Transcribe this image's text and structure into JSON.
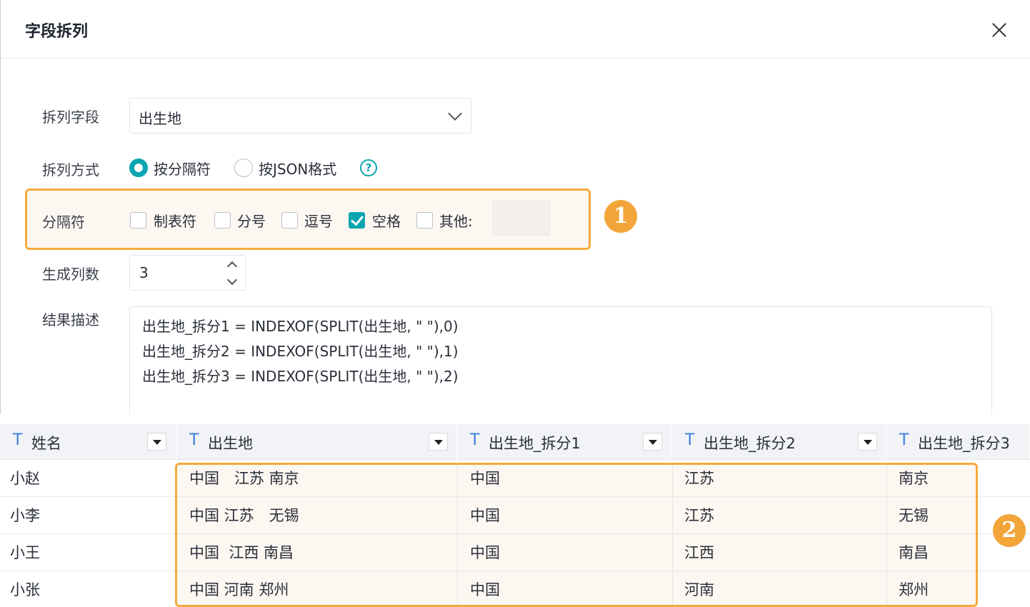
{
  "dialog": {
    "title": "字段拆列",
    "close_icon": "close-icon"
  },
  "form": {
    "split_field": {
      "label": "拆列字段",
      "value": "出生地"
    },
    "split_method": {
      "label": "拆列方式",
      "options": [
        {
          "label": "按分隔符",
          "selected": true
        },
        {
          "label": "按JSON格式",
          "selected": false
        }
      ],
      "help_icon": "?"
    },
    "separator": {
      "label": "分隔符",
      "options": [
        {
          "label": "制表符",
          "checked": false
        },
        {
          "label": "分号",
          "checked": false
        },
        {
          "label": "逗号",
          "checked": false
        },
        {
          "label": "空格",
          "checked": true
        },
        {
          "label": "其他:",
          "checked": false
        }
      ],
      "other_value": ""
    },
    "column_count": {
      "label": "生成列数",
      "value": "3"
    },
    "result": {
      "label": "结果描述",
      "lines": [
        "出生地_拆分1 = INDEXOF(SPLIT(出生地, \" \"),0)",
        "出生地_拆分2 = INDEXOF(SPLIT(出生地, \" \"),1)",
        "出生地_拆分3 = INDEXOF(SPLIT(出生地, \" \"),2)"
      ]
    }
  },
  "badges": {
    "one": "1",
    "two": "2"
  },
  "colors": {
    "accent": "#0aa5b0",
    "highlight": "#f3ab3c",
    "badge": "#f3a53a",
    "type_icon": "#3c7ee0"
  },
  "table": {
    "type_icon": "T",
    "columns": [
      "姓名",
      "出生地",
      "出生地_拆分1",
      "出生地_拆分2",
      "出生地_拆分3"
    ],
    "rows": [
      [
        "小赵",
        "中国　江苏 南京",
        "中国",
        "江苏",
        "南京"
      ],
      [
        "小李",
        "中国 江苏　无锡",
        "中国",
        "江苏",
        "无锡"
      ],
      [
        "小王",
        "中国  江西 南昌",
        "中国",
        "江西",
        "南昌"
      ],
      [
        "小张",
        "中国 河南 郑州",
        "中国",
        "河南",
        "郑州"
      ]
    ]
  }
}
